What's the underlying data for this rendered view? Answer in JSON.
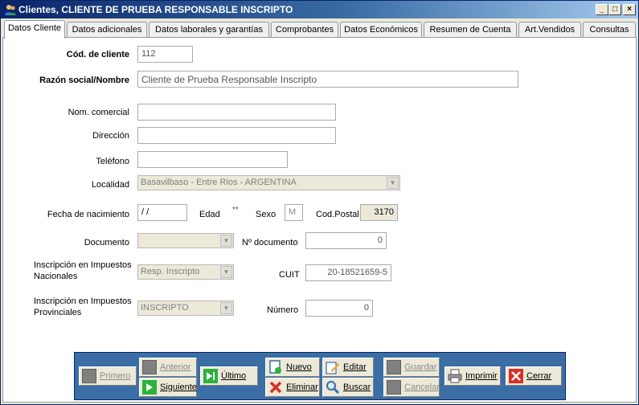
{
  "window": {
    "title": "Clientes, CLIENTE DE PRUEBA RESPONSABLE INSCRIPTO",
    "min_glyph": "_",
    "max_glyph": "□",
    "close_glyph": "×"
  },
  "tabs": [
    {
      "label": "Datos Cliente"
    },
    {
      "label": "Datos adicionales"
    },
    {
      "label": "Datos laborales y garantías"
    },
    {
      "label": "Comprobantes"
    },
    {
      "label": "Datos Económicos"
    },
    {
      "label": "Resumen de Cuenta"
    },
    {
      "label": "Art.Vendidos"
    },
    {
      "label": "Consultas"
    }
  ],
  "form": {
    "cod_cliente": {
      "label": "Cód. de cliente",
      "value": "112"
    },
    "razon_social": {
      "label": "Razón social/Nombre",
      "value": "Cliente de Prueba Responsable Inscripto"
    },
    "nom_comercial": {
      "label": "Nom. comercial",
      "value": ""
    },
    "direccion": {
      "label": "Dirección",
      "value": ""
    },
    "telefono": {
      "label": "Teléfono",
      "value": ""
    },
    "localidad": {
      "label": "Localidad",
      "value": "Basavilbaso - Entre Rios - ARGENTINA"
    },
    "fecha_nacimiento": {
      "label": "Fecha de nacimiento",
      "value": " / /"
    },
    "edad": {
      "label": "Edad",
      "value": "**"
    },
    "sexo": {
      "label": "Sexo",
      "value": "M"
    },
    "cod_postal": {
      "label": "Cod.Postal",
      "value": "3170"
    },
    "documento": {
      "label": "Documento",
      "value": ""
    },
    "nro_documento": {
      "label": "Nº documento",
      "value": "0"
    },
    "insc_nacionales": {
      "label_line1": "Inscripción en Impuestos",
      "label_line2": "Nacionales",
      "value": "Resp. Inscripto"
    },
    "cuit": {
      "label": "CUIT",
      "value": "20-18521659-5"
    },
    "insc_provinciales": {
      "label_line1": "Inscripción en Impuestos",
      "label_line2": "Provinciales",
      "value": "INSCRIPTO"
    },
    "numero": {
      "label": "Número",
      "value": "0"
    }
  },
  "toolbar": {
    "primero": "Primero",
    "anterior": "Anterior",
    "siguiente": "Siguiente",
    "ultimo": "Último",
    "nuevo": "Nuevo",
    "eliminar": "Eliminar",
    "editar": "Editar",
    "buscar": "Buscar",
    "guardar": "Guardar",
    "cancelar": "Cancelar",
    "imprimir": "Imprimir",
    "cerrar": "Cerrar"
  },
  "colors": {
    "titlebar": "#0a246a",
    "toolbar": "#3a6ea5",
    "accent_green": "#2bb23c",
    "accent_red": "#d93025"
  }
}
